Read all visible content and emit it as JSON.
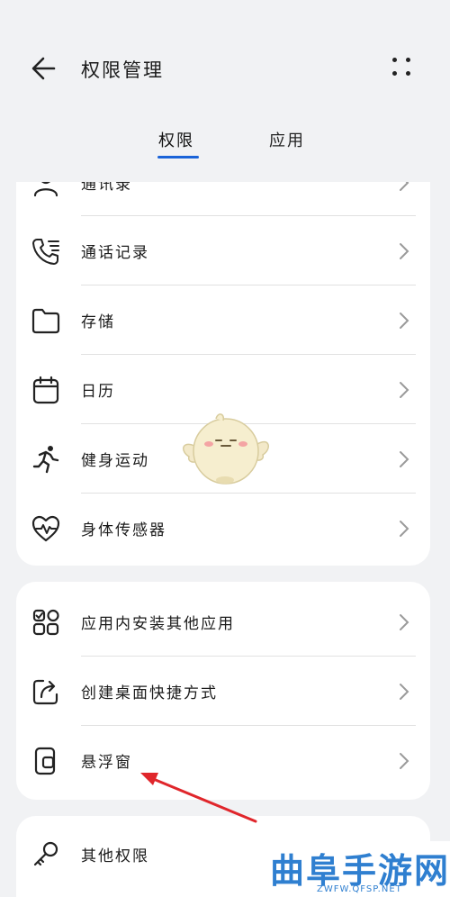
{
  "header": {
    "title": "权限管理",
    "back_icon": "arrow-left-icon",
    "more_icon": "more-dots-icon"
  },
  "tabs": [
    {
      "label": "权限",
      "active": true
    },
    {
      "label": "应用",
      "active": false
    }
  ],
  "group1": {
    "items": [
      {
        "label": "通讯录",
        "icon": "contacts-icon"
      },
      {
        "label": "通话记录",
        "icon": "call-log-icon"
      },
      {
        "label": "存储",
        "icon": "folder-icon"
      },
      {
        "label": "日历",
        "icon": "calendar-icon"
      },
      {
        "label": "健身运动",
        "icon": "running-icon"
      },
      {
        "label": "身体传感器",
        "icon": "heart-pulse-icon"
      }
    ]
  },
  "group2": {
    "items": [
      {
        "label": "应用内安装其他应用",
        "icon": "apps-grid-icon"
      },
      {
        "label": "创建桌面快捷方式",
        "icon": "shortcut-icon"
      },
      {
        "label": "悬浮窗",
        "icon": "floating-window-icon"
      }
    ]
  },
  "group3": {
    "items": [
      {
        "label": "其他权限",
        "icon": "key-icon"
      }
    ]
  },
  "watermark": {
    "brand": "曲阜手游网",
    "url": "ZWFW.QFSP.NET"
  },
  "colors": {
    "accent": "#1a63d8",
    "annotation_arrow": "#e0262b",
    "background": "#f1f2f4"
  }
}
